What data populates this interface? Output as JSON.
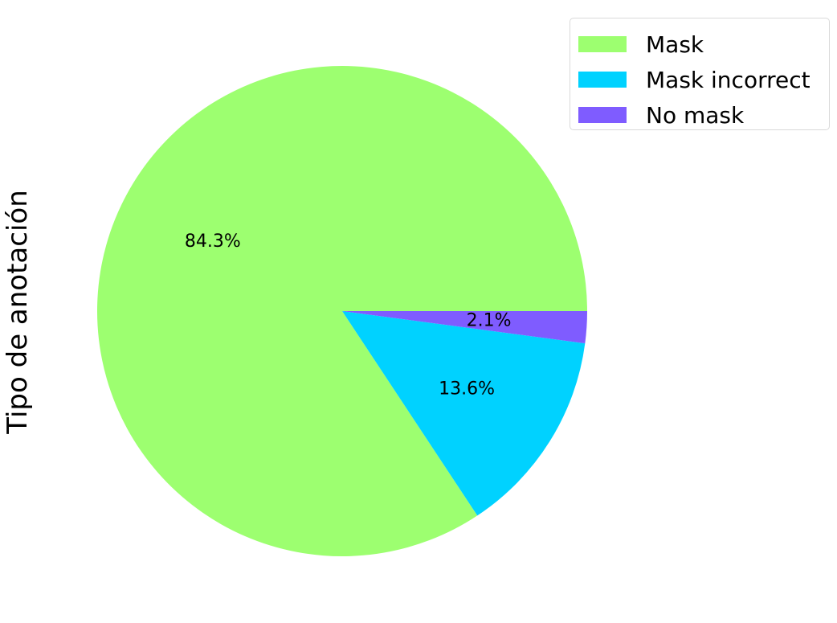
{
  "chart_data": {
    "type": "pie",
    "ylabel": "Tipo de anotación",
    "categories": [
      "Mask",
      "Mask incorrect",
      "No mask"
    ],
    "values": [
      84.3,
      13.6,
      2.1
    ],
    "value_labels": [
      "84.3%",
      "13.6%",
      "2.1%"
    ],
    "colors": [
      "#9dff70",
      "#00d2ff",
      "#7f5cff"
    ],
    "legend": {
      "placement": "top-right",
      "items": [
        {
          "label": "Mask",
          "color": "#9dff70"
        },
        {
          "label": "Mask incorrect",
          "color": "#00d2ff"
        },
        {
          "label": "No mask",
          "color": "#7f5cff"
        }
      ]
    }
  }
}
